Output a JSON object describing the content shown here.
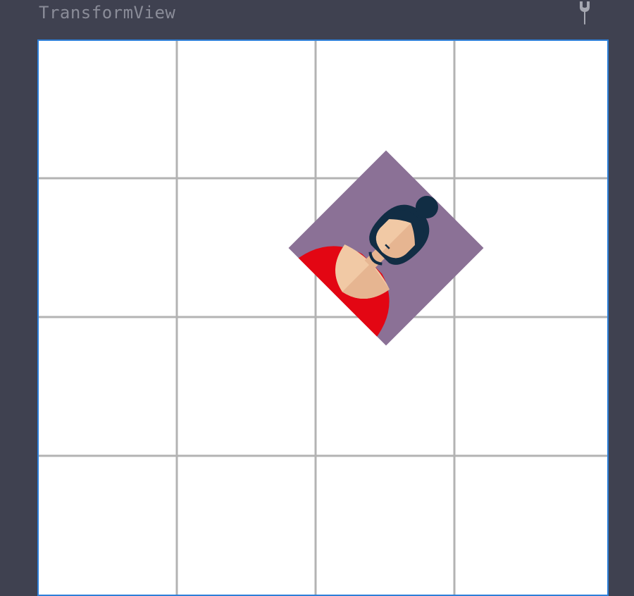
{
  "window": {
    "title": "TransformView",
    "settings_icon": "wrench-icon"
  },
  "view": {
    "grid": {
      "rows": 4,
      "cols": 4,
      "visible": true
    },
    "transform": {
      "rotation_deg": 45
    },
    "image": {
      "icon": "avatar-woman-icon",
      "description_colors": {
        "background": "#8b7196",
        "hair": "#112d44",
        "skin": "#f1c9a5",
        "skin_shade": "#e6b591",
        "shirt": "#e30613"
      }
    }
  },
  "colors": {
    "window_bg": "#3f4150",
    "canvas_bg": "#ffffff",
    "canvas_border": "#2d7fd8",
    "grid_line": "#b3b3b3",
    "title_text": "#8a8c98"
  }
}
